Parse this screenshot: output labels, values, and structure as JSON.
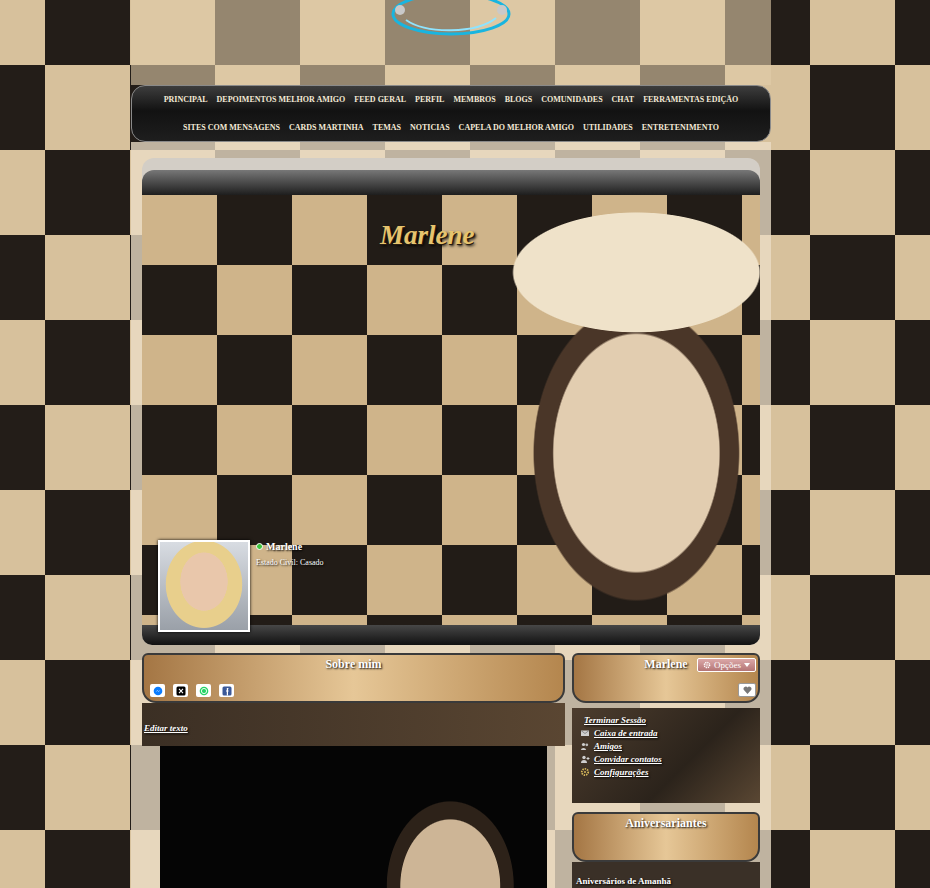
{
  "nav": {
    "rows": [
      [
        "PRINCIPAL",
        "DEPOIMENTOS MELHOR AMIGO",
        "FEED GERAL",
        "PERFIL",
        "MEMBROS",
        "BLOGS",
        "COMUNIDADES",
        "CHAT",
        "FERRAMENTAS EDIÇÃO"
      ],
      [
        "SITES COM MENSAGENS",
        "CARDS MARTINHA",
        "TEMAS",
        "NOTICIAS",
        "CAPELA DO MELHOR AMIGO",
        "UTILIDADES",
        "ENTRETENIMENTO"
      ]
    ]
  },
  "profile": {
    "title": "Marlene",
    "name": "Marlene",
    "online": true,
    "status_line": "Estado Civil: Casado"
  },
  "about": {
    "title": "Sobre mim",
    "edit_link": "Editar texto"
  },
  "share_buttons": [
    {
      "kind": "messenger",
      "color": "#0a7cff"
    },
    {
      "kind": "x",
      "color": "#000000"
    },
    {
      "kind": "whatsapp",
      "color": "#25d366"
    },
    {
      "kind": "facebook",
      "color": "#3b5998"
    }
  ],
  "sidebar": {
    "title": "Marlene",
    "options_button": "Opções",
    "links": [
      {
        "label": "Terminar Sessão",
        "kind": "logout"
      },
      {
        "label": "Caixa de entrada",
        "kind": "inbox"
      },
      {
        "label": "Amigos",
        "kind": "friends"
      },
      {
        "label": "Convidar contatos",
        "kind": "invite"
      },
      {
        "label": "Configurações",
        "kind": "settings"
      }
    ]
  },
  "birthdays": {
    "title": "Aniversariantes",
    "subtitle": "Aniversários de Amanhã"
  }
}
